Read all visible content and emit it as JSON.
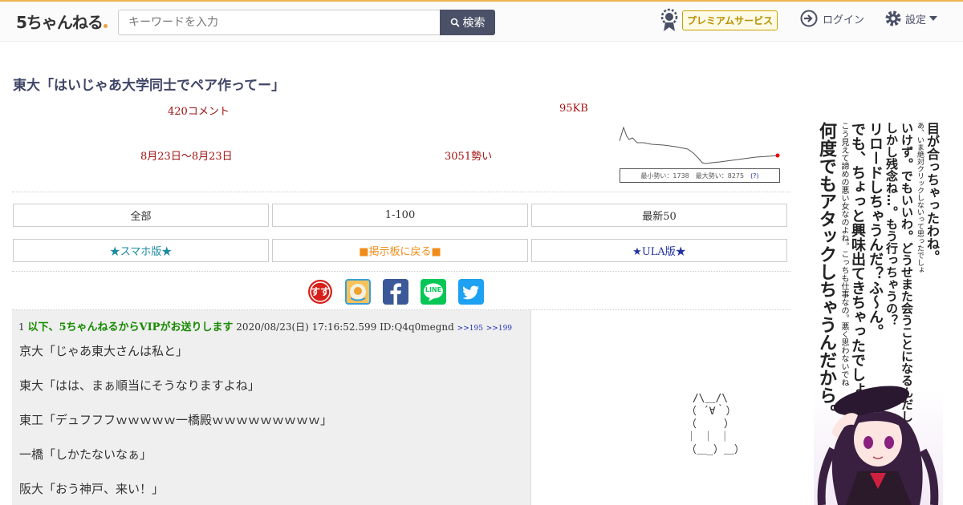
{
  "header": {
    "logo_text": "5ちゃんねる",
    "search_placeholder": "キーワードを入力",
    "search_button": "検索",
    "premium_label": "プレミアムサービス",
    "login_label": "ログイン",
    "settings_label": "設定"
  },
  "thread": {
    "title": "東大「はいじゃあ大学同士でペア作ってー」",
    "comments": "420コメント",
    "size": "95KB",
    "date_range": "8月23日〜8月23日",
    "momentum": "3051勢い",
    "chart_stats": "最小勢い：1738　最大勢い：8275",
    "chart_help": "(?)"
  },
  "nav": {
    "all": "全部",
    "range": "1-100",
    "latest": "最新50",
    "smartphone": "★スマホ版★",
    "back_to_board": "■掲示板に戻る■",
    "ula": "★ULA版★"
  },
  "share": {
    "icons": [
      "susu-icon",
      "matome-icon",
      "facebook-icon",
      "line-icon",
      "twitter-icon"
    ],
    "line_label": "LINE",
    "susu_label": "すす"
  },
  "post": {
    "number": "1",
    "name": "以下、5ちゃんねるからVIPがお送りします",
    "datetime": "2020/08/23(日) 17:16:52.599 ID:Q4q0megnd",
    "refs": [
      ">>195",
      ">>199"
    ],
    "lines": [
      "京大「じゃあ東大さんは私と」",
      "東大「はは、まぁ順当にそうなりますよね」",
      "東工「デュフフフｗｗｗｗｗ一橋殿ｗｗｗｗｗｗｗｗｗ」",
      "一橋「しかたないなぁ」",
      "阪大「おう神戸、来い！」"
    ],
    "ascii_art": " /\\＿/\\\n（ ´∀｀）\n（　　 ）\n｜ ｜ ｜\n（＿_）＿）"
  },
  "ad": {
    "columns": [
      "目が合っちゃったわね。",
      "あ、いま絶対クリックしないって思ったでしょ",
      "いけず。でもいいわ。どうせまた会うことになるんだし",
      "しかし残念ね…。もう行っちゃうの？",
      "リロードしちゃうんだ？ふ〜ん。",
      "でも、ちょっと興味出てきちゃったでしょ？",
      "こう見えて諦めの悪い女なのよね。こっちも仕事なの。悪く思わないでね",
      "何度でもアタックしちゃうんだから。"
    ]
  },
  "colors": {
    "accent": "#f0b350",
    "nav_dark": "#4a5066",
    "meta_red": "#a01010",
    "name_green": "#178a00",
    "ula_blue": "#2030a0",
    "board_orange": "#f08c1a",
    "sp_teal": "#1a8aa0"
  }
}
